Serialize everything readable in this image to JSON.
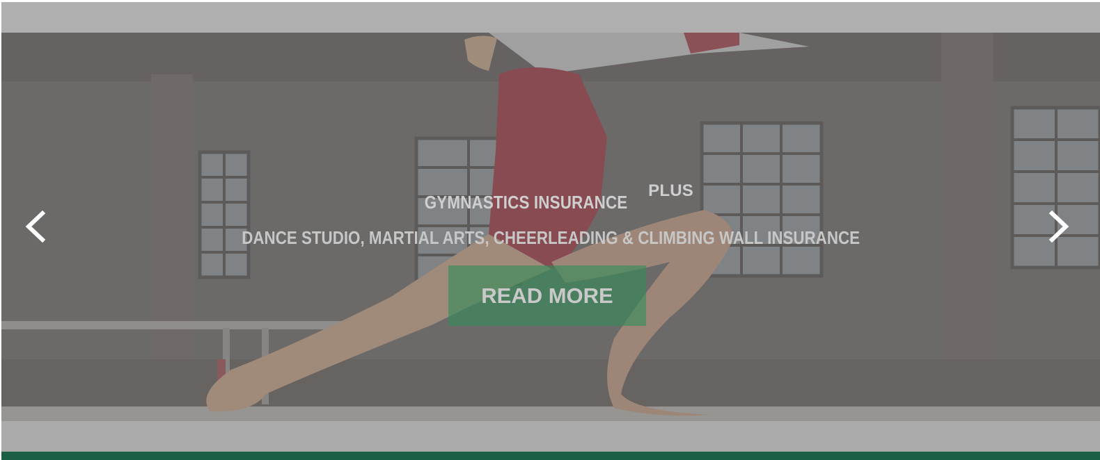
{
  "hero": {
    "title": "GYMNASTICS INSURANCE",
    "title_suffix": "PLUS",
    "subtitle": "DANCE STUDIO, MARTIAL ARTS, CHEERLEADING & CLIMBING WALL INSURANCE",
    "cta_label": "READ MORE"
  },
  "slider": {
    "prev_icon": "chevron-left-icon",
    "next_icon": "chevron-right-icon",
    "image": "gymnast-lunge-on-beam-photo"
  },
  "colors": {
    "overlay": "#afafaf",
    "cta": "#338c58",
    "footer_bar": "#1b5f44",
    "text": "#cfcfcf"
  }
}
